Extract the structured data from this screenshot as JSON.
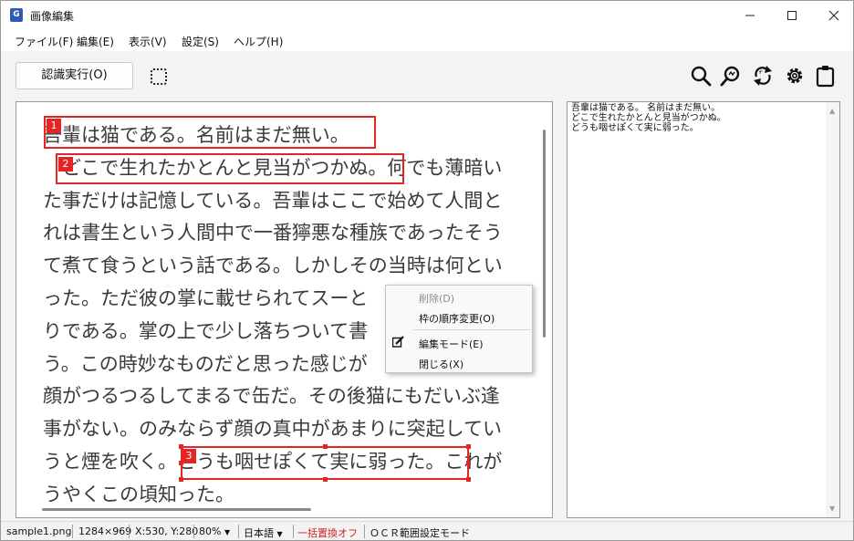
{
  "window": {
    "title": "画像編集",
    "app_icon": "G"
  },
  "menu": [
    {
      "label": "ファイル(F)"
    },
    {
      "label": "編集(E)"
    },
    {
      "label": "表示(V)"
    },
    {
      "label": "設定(S)"
    },
    {
      "label": "ヘルプ(H)"
    }
  ],
  "toolbar": {
    "run_label": "認識実行(O)",
    "icons": [
      "search-icon",
      "zoom-icon",
      "rotate-icon",
      "settings-icon",
      "clipboard-icon"
    ]
  },
  "image_text": {
    "lines": [
      "吾輩は猫である。名前はまだ無い。",
      "　どこで生れたかとんと見当がつかぬ。何でも薄暗い",
      "た事だけは記憶している。吾輩はここで始めて人間と",
      "れは書生という人間中で一番獰悪な種族であったそう",
      "て煮て食うという話である。しかしその当時は何とい",
      "った。ただ彼の掌に載せられてスーと",
      "りである。掌の上で少し落ちついて書",
      "う。この時妙なものだと思った感じが",
      "顔がつるつるしてまるで缶だ。その後猫にもだいぶ逢",
      "事がない。のみならず顔の真中があまりに突起してい",
      "うと煙を吹く。どうも咽せぽくて実に弱った。これが",
      "うやくこの頃知った。"
    ]
  },
  "ocr_boxes": [
    {
      "label": "1"
    },
    {
      "label": "2"
    },
    {
      "label": "3"
    }
  ],
  "context_menu": {
    "items": [
      {
        "label": "削除(D)",
        "disabled": true
      },
      {
        "label": "枠の順序変更(O)",
        "disabled": false
      },
      {
        "label": "編集モード(E)",
        "disabled": false,
        "checked": true
      },
      {
        "label": "閉じる(X)",
        "disabled": false
      }
    ]
  },
  "ocr_result": {
    "lines": [
      "吾輩は猫である。 名前はまだ無い。",
      "どこで生れたかとんと見当がつかぬ。",
      "どうも咽せぽくて実に弱った。"
    ]
  },
  "status": {
    "file": "sample1.png",
    "size": "1284×969",
    "coords": "X:530, Y:280",
    "zoom": "80%",
    "language": "日本語",
    "replace": "一括置換オフ",
    "mode": "ＯＣＲ範囲設定モード"
  },
  "colors": {
    "box": "#e32525",
    "status_warning": "#d32020"
  }
}
